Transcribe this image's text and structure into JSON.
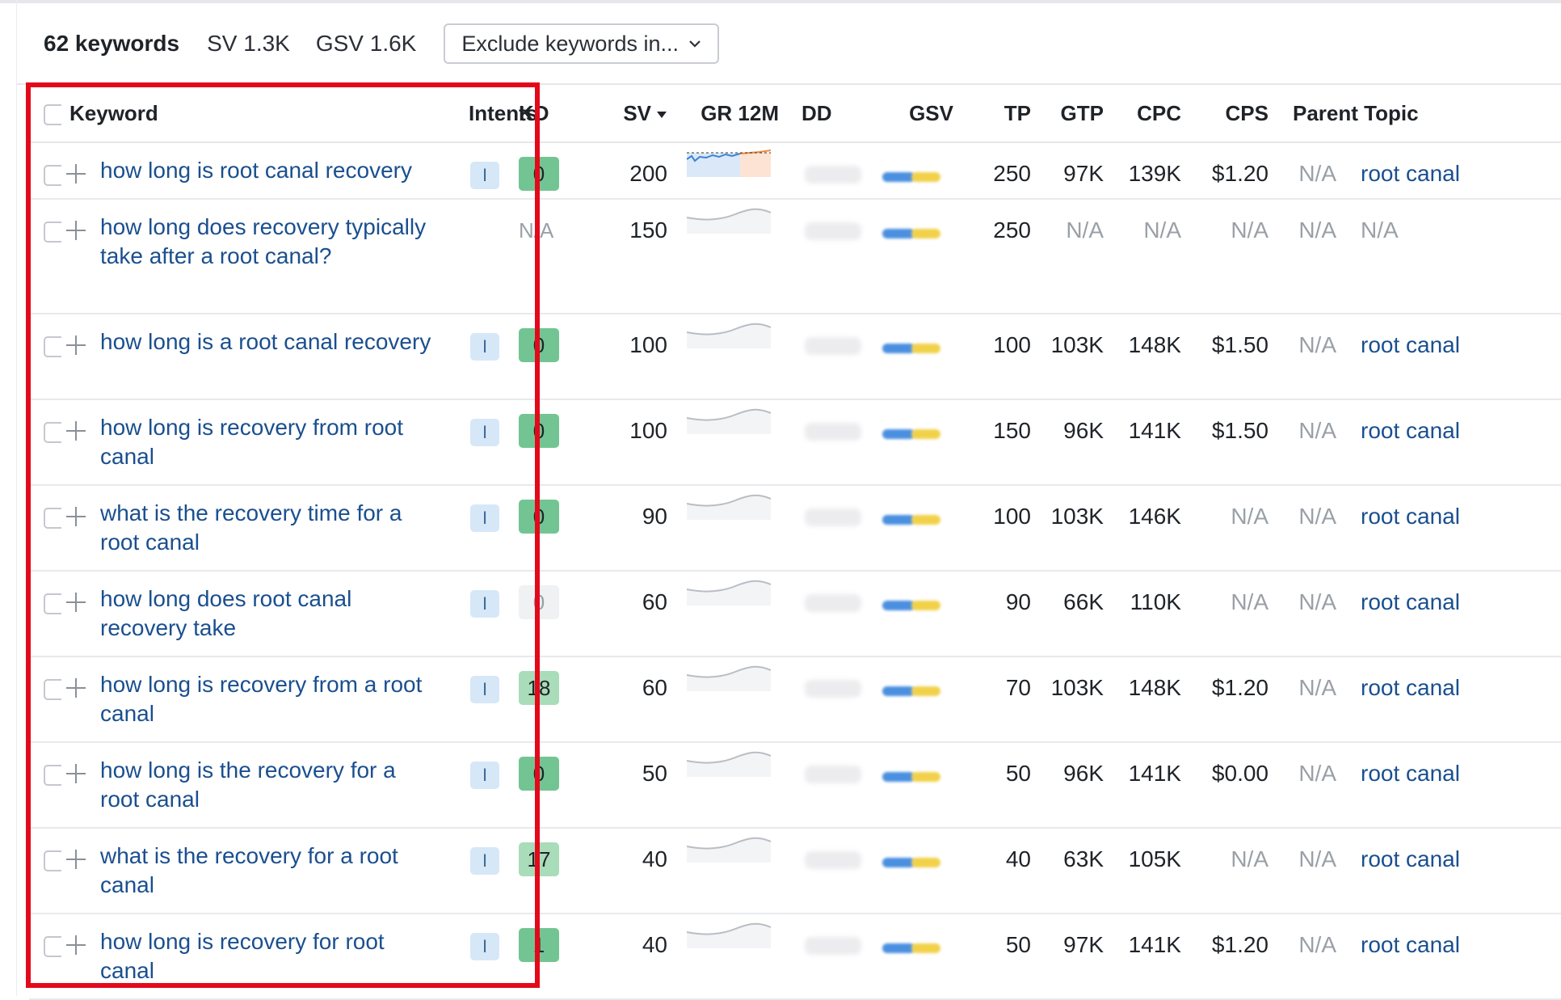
{
  "summary": {
    "keyword_count": "62 keywords",
    "sv": "SV 1.3K",
    "gsv": "GSV 1.6K",
    "exclude_button": "Exclude keywords in..."
  },
  "columns": {
    "keyword": "Keyword",
    "intents": "Intents",
    "kd": "KD",
    "sv": "SV",
    "gr12m": "GR 12M",
    "dd": "DD",
    "gsv": "GSV",
    "tp": "TP",
    "gtp": "GTP",
    "cpc": "CPC",
    "cps": "CPS",
    "parent_topic": "Parent Topic"
  },
  "colors": {
    "kd_easy": "#72c592",
    "kd_light": "#a9dcb8",
    "kd_zero_gray": "#f0f1f3",
    "highlight": "#e3091b"
  },
  "rows": [
    {
      "keyword": "how long is root canal recovery",
      "intent": "I",
      "kd": "0",
      "sv": "200",
      "gsv": "250",
      "tp": "97K",
      "gtp": "139K",
      "cpc": "$1.20",
      "cps": "N/A",
      "parent_topic": "root canal"
    },
    {
      "keyword": "how long does recovery typically take after a root canal?",
      "intent": "",
      "kd": "N/A",
      "sv": "150",
      "gsv": "250",
      "tp": "N/A",
      "gtp": "N/A",
      "cpc": "N/A",
      "cps": "N/A",
      "parent_topic": "N/A"
    },
    {
      "keyword": "how long is a root canal recovery",
      "intent": "I",
      "kd": "0",
      "sv": "100",
      "gsv": "100",
      "tp": "103K",
      "gtp": "148K",
      "cpc": "$1.50",
      "cps": "N/A",
      "parent_topic": "root canal"
    },
    {
      "keyword": "how long is recovery from root canal",
      "intent": "I",
      "kd": "0",
      "sv": "100",
      "gsv": "150",
      "tp": "96K",
      "gtp": "141K",
      "cpc": "$1.50",
      "cps": "N/A",
      "parent_topic": "root canal"
    },
    {
      "keyword": "what is the recovery time for a root canal",
      "intent": "I",
      "kd": "0",
      "sv": "90",
      "gsv": "100",
      "tp": "103K",
      "gtp": "146K",
      "cpc": "N/A",
      "cps": "N/A",
      "parent_topic": "root canal"
    },
    {
      "keyword": "how long does root canal recovery take",
      "intent": "I",
      "kd": "0",
      "sv": "60",
      "gsv": "90",
      "tp": "66K",
      "gtp": "110K",
      "cpc": "N/A",
      "cps": "N/A",
      "parent_topic": "root canal"
    },
    {
      "keyword": "how long is recovery from a root canal",
      "intent": "I",
      "kd": "18",
      "sv": "60",
      "gsv": "70",
      "tp": "103K",
      "gtp": "148K",
      "cpc": "$1.20",
      "cps": "N/A",
      "parent_topic": "root canal"
    },
    {
      "keyword": "how long is the recovery for a root canal",
      "intent": "I",
      "kd": "0",
      "sv": "50",
      "gsv": "50",
      "tp": "96K",
      "gtp": "141K",
      "cpc": "$0.00",
      "cps": "N/A",
      "parent_topic": "root canal"
    },
    {
      "keyword": "what is the recovery for a root canal",
      "intent": "I",
      "kd": "17",
      "sv": "40",
      "gsv": "40",
      "tp": "63K",
      "gtp": "105K",
      "cpc": "N/A",
      "cps": "N/A",
      "parent_topic": "root canal"
    },
    {
      "keyword": "how long is recovery for root canal",
      "intent": "I",
      "kd": "1",
      "sv": "40",
      "gsv": "50",
      "tp": "97K",
      "gtp": "141K",
      "cpc": "$1.20",
      "cps": "N/A",
      "parent_topic": "root canal"
    }
  ]
}
